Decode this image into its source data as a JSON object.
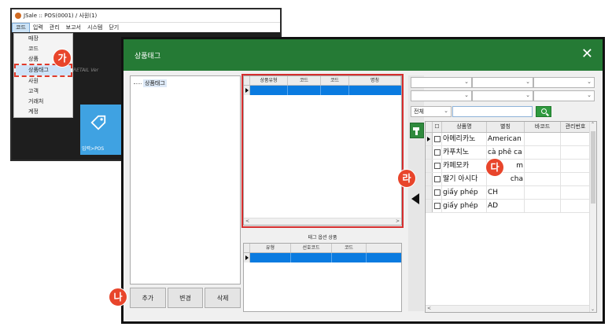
{
  "app": {
    "title": "JSale  ::  POS(0001) / 사원(1)",
    "menu": [
      "코드",
      "입력",
      "관리",
      "보고서",
      "시스템",
      "닫기"
    ],
    "dropdown": [
      "매장",
      "코드",
      "상품",
      "상품태그",
      "사원",
      "고객",
      "거래처",
      "계정"
    ],
    "retail_text": "RETAIL Ver",
    "pos_tile_label": "입력>POS"
  },
  "badges": {
    "ga": "가",
    "na": "나",
    "da": "다",
    "ra": "라"
  },
  "dialog": {
    "title": "상품태그",
    "close": "✕",
    "tree_root": "상품태그",
    "buttons": {
      "add": "추가",
      "edit": "변경",
      "delete": "삭제"
    },
    "tag_grid_columns": [
      "상품유형",
      "코드",
      "코드",
      "명칭"
    ],
    "option_caption": "태그 옵션 상품",
    "option_grid_columns": [
      "유형",
      "선호코드",
      "코드"
    ],
    "filter": {
      "type_select": "전체"
    },
    "product_grid": {
      "columns": [
        "상품명",
        "별칭",
        "바코드",
        "관리번호"
      ],
      "rows": [
        {
          "name": "아메리카노",
          "alias": "American"
        },
        {
          "name": "카푸치노",
          "alias": "cà phê ca"
        },
        {
          "name": "카페모카",
          "alias": "m"
        },
        {
          "name": "딸기 아시다",
          "alias": "cha"
        },
        {
          "name": "giấy phép",
          "alias": "CH"
        },
        {
          "name": "giấy phép",
          "alias": "AD"
        }
      ]
    }
  },
  "colors": {
    "dialog_title_bg": "#257a35",
    "badge": "#e8452b",
    "selection": "#0a7be0",
    "highlight_frame": "#d62e2e"
  }
}
